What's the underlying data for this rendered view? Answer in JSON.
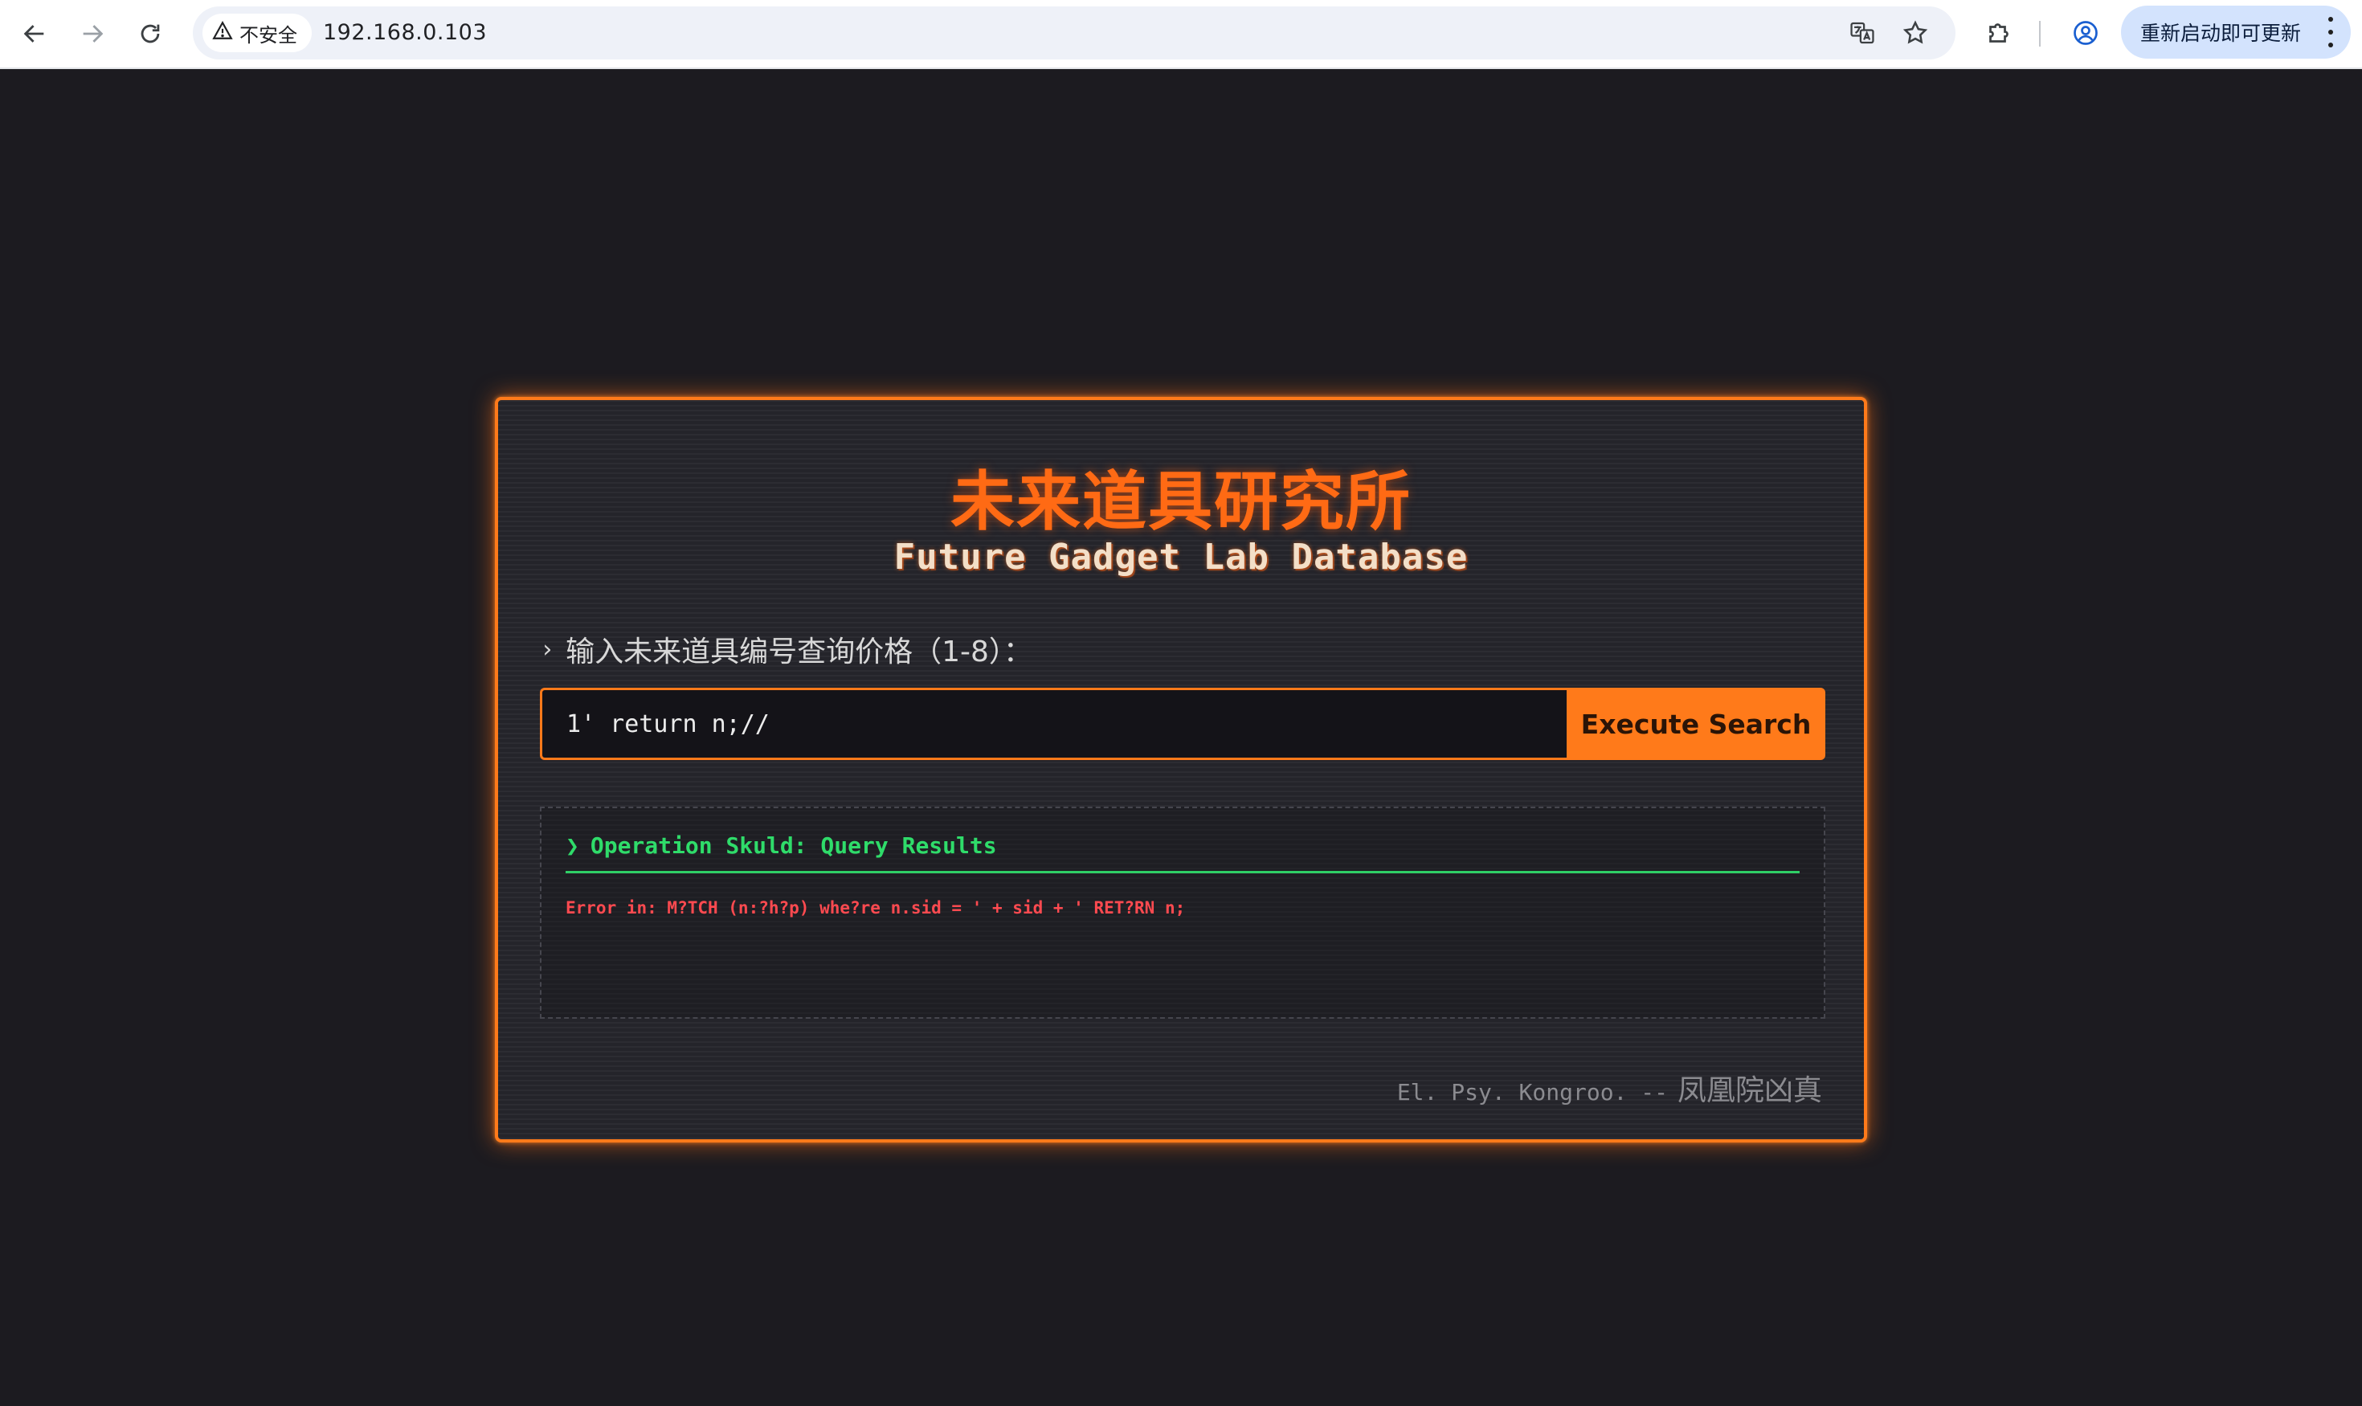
{
  "browser": {
    "security_label": "不安全",
    "url": "192.168.0.103",
    "update_button_label": "重新启动即可更新",
    "icons": {
      "back": "back-arrow-icon",
      "forward": "forward-arrow-icon",
      "reload": "reload-icon",
      "security": "warning-triangle-icon",
      "translate": "translate-icon",
      "bookmark": "star-icon",
      "extensions": "puzzle-icon",
      "profile": "profile-icon",
      "menu": "kebab-menu-icon"
    }
  },
  "page": {
    "title_cn": "未来道具研究所",
    "title_en": "Future Gadget Lab Database",
    "prompt_chevron": "›",
    "prompt_label": "输入未来道具编号查询价格（1-8）：",
    "search": {
      "value": "1' return n;//",
      "button_label": "Execute Search"
    },
    "results": {
      "chevron": "❯",
      "heading": "Operation Skuld: Query Results",
      "error_text": "Error in: M?TCH (n:?h?p) whe?re n.sid = ' + sid + ' RET?RN n;"
    },
    "footer": {
      "quote": "El. Psy. Kongroo. --",
      "author": "凤凰院凶真"
    },
    "colors": {
      "accent": "#ff7a1a",
      "background": "#1c1b20",
      "success": "#2fdc6a",
      "error": "#ff4a50"
    }
  }
}
